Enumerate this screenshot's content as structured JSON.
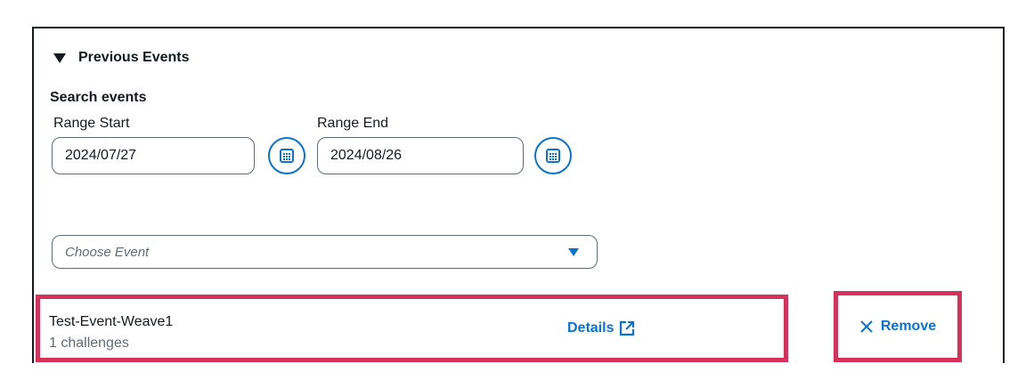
{
  "section": {
    "title": "Previous Events"
  },
  "search": {
    "label": "Search events",
    "range_start": {
      "label": "Range Start",
      "value": "2024/07/27"
    },
    "range_end": {
      "label": "Range End",
      "value": "2024/08/26"
    }
  },
  "event_select": {
    "placeholder": "Choose Event"
  },
  "event": {
    "name": "Test-Event-Weave1",
    "challenges": "1 challenges",
    "details_label": "Details",
    "remove_label": "Remove"
  },
  "colors": {
    "accent": "#0972d3",
    "highlight": "#d6315a",
    "text": "#16191f",
    "muted": "#5f6b7a"
  },
  "icons": [
    "caret-down-icon",
    "calendar-icon",
    "dropdown-caret-icon",
    "external-link-icon",
    "close-icon"
  ]
}
